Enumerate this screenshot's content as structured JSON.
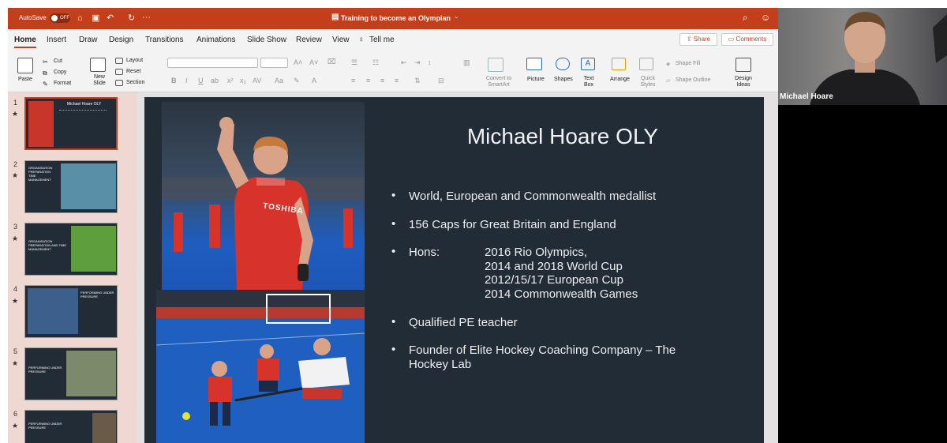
{
  "titlebar": {
    "autosave_label": "AutoSave",
    "autosave_state": "OFF",
    "doc_title": "Training to become an Olympian"
  },
  "tabs": [
    "Home",
    "Insert",
    "Draw",
    "Design",
    "Transitions",
    "Animations",
    "Slide Show",
    "Review",
    "View",
    "Tell me"
  ],
  "actions": {
    "share": "Share",
    "comments": "Comments"
  },
  "ribbon": {
    "paste": "Paste",
    "cut": "Cut",
    "copy": "Copy",
    "format": "Format",
    "new_slide": "New Slide",
    "layout": "Layout",
    "reset": "Reset",
    "section": "Section",
    "convert": "Convert to SmartArt",
    "picture": "Picture",
    "shapes": "Shapes",
    "text_box": "Text Box",
    "arrange": "Arrange",
    "quick_styles": "Quick Styles",
    "shape_fill": "Shape Fill",
    "shape_outline": "Shape Outline",
    "design_ideas": "Design Ideas",
    "font_name": "",
    "font_size": ""
  },
  "thumbnails": [
    {
      "num": "1",
      "title": "Michael Hoare OLY"
    },
    {
      "num": "2",
      "title": "ORGANISATION PREPARATION TIME MANAGEMENT"
    },
    {
      "num": "3",
      "title": "ORGANISATION PREPARATION AND TIME MANAGEMENT"
    },
    {
      "num": "4",
      "title": "PERFORMING UNDER PRESSURE"
    },
    {
      "num": "5",
      "title": "PERFORMING UNDER PRESSURE"
    },
    {
      "num": "6",
      "title": "PERFORMING UNDER PRESSURE"
    }
  ],
  "slide": {
    "title": "Michael Hoare OLY",
    "bullets": [
      "World, European and Commonwealth medallist",
      "156 Caps for Great Britain and England",
      "Hons:",
      "Qualified PE teacher",
      "Founder of Elite Hockey Coaching Company – The",
      "Hockey Lab"
    ],
    "hons": [
      "2016 Rio Olympics,",
      "2014 and 2018 World Cup",
      "2012/15/17 European Cup",
      "2014 Commonwealth Games"
    ],
    "jersey": "TOSHIBA"
  },
  "participant": {
    "name": "Michael Hoare"
  },
  "colors": {
    "titlebar": "#c43e1c",
    "slide_bg": "#222c36",
    "accent": "#c43e1c",
    "pitch": "#1f5fc0"
  }
}
